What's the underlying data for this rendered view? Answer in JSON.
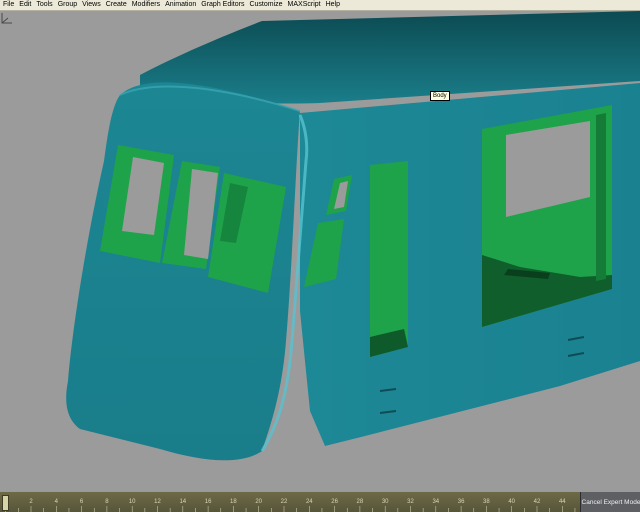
{
  "menubar": {
    "items": [
      "File",
      "Edit",
      "Tools",
      "Group",
      "Views",
      "Create",
      "Modifiers",
      "Animation",
      "Graph Editors",
      "Customize",
      "MAXScript",
      "Help"
    ]
  },
  "viewport": {
    "tooltip": "Body",
    "object_color": "#1e8f9c",
    "interior_color": "#1fa34a",
    "background_color": "#9b9b9b"
  },
  "timeline": {
    "ticks": [
      "2",
      "4",
      "6",
      "8",
      "10",
      "12",
      "14",
      "16",
      "18",
      "20",
      "22",
      "24",
      "26",
      "28",
      "30",
      "32",
      "34",
      "36",
      "38",
      "40",
      "42",
      "44"
    ],
    "current_frame": 0
  },
  "expert_mode": {
    "label": "Cancel Expert Mode"
  }
}
